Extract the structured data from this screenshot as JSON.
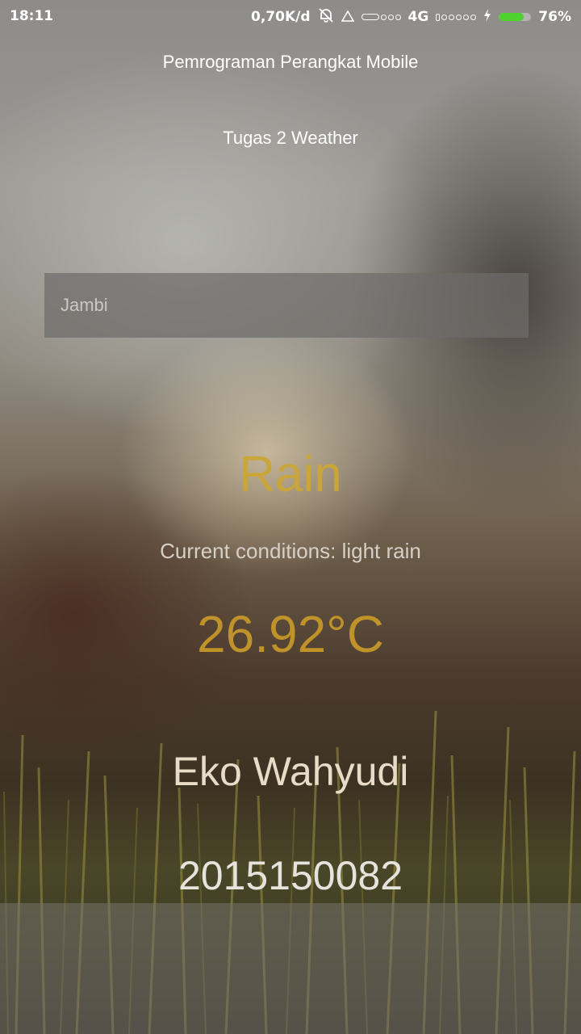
{
  "status_bar": {
    "time": "18:11",
    "network_speed": "0,70K/d",
    "network_type": "4G",
    "battery_percent": "76%",
    "battery_level": 0.76,
    "icons": [
      "mute-alarm-icon",
      "warning-triangle-icon",
      "signal-strength-icon",
      "charging-bolt-icon"
    ]
  },
  "header": {
    "title": "Pemrograman Perangkat Mobile",
    "subtitle": "Tugas 2 Weather"
  },
  "search": {
    "placeholder": "Jambi",
    "value": ""
  },
  "weather": {
    "main": "Rain",
    "conditions": "Current conditions: light rain",
    "temperature": "26.92°C"
  },
  "author": {
    "name": "Eko Wahyudi",
    "id": "2015150082"
  },
  "colors": {
    "weather_main": "#c9a53a",
    "temperature": "#c0922a",
    "battery": "#4fd12e"
  }
}
